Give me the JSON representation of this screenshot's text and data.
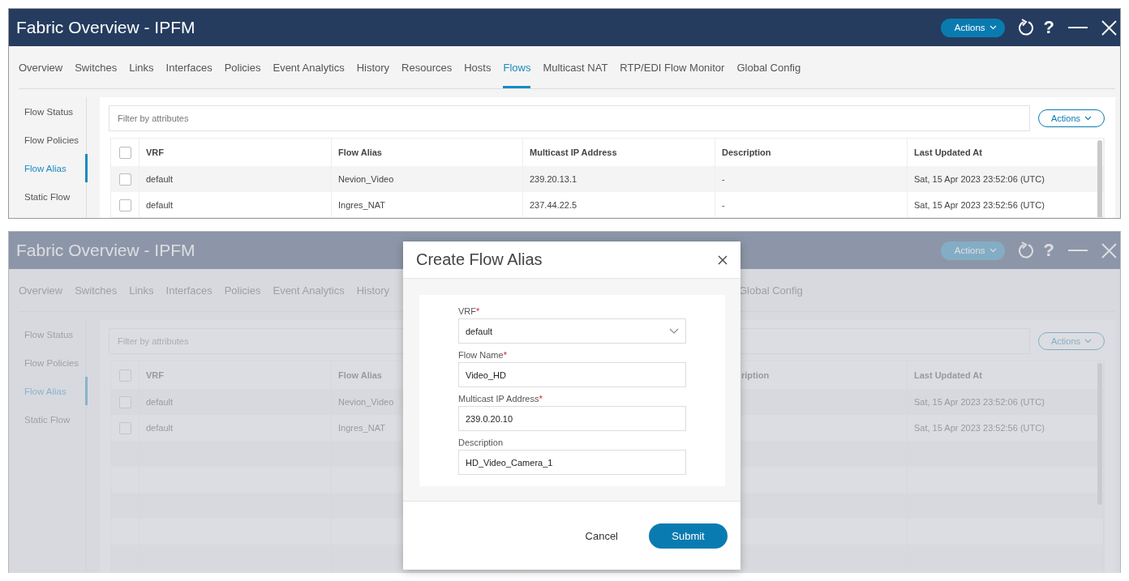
{
  "main_window": {
    "title": "Fabric Overview - IPFM",
    "header_actions_button": "Actions",
    "help_button": "?",
    "tabs": [
      {
        "label": "Overview",
        "selected": false
      },
      {
        "label": "Switches",
        "selected": false
      },
      {
        "label": "Links",
        "selected": false
      },
      {
        "label": "Interfaces",
        "selected": false
      },
      {
        "label": "Policies",
        "selected": false
      },
      {
        "label": "Event Analytics",
        "selected": false
      },
      {
        "label": "History",
        "selected": false
      },
      {
        "label": "Resources",
        "selected": false
      },
      {
        "label": "Hosts",
        "selected": false
      },
      {
        "label": "Flows",
        "selected": true
      },
      {
        "label": "Multicast NAT",
        "selected": false
      },
      {
        "label": "RTP/EDI Flow Monitor",
        "selected": false
      },
      {
        "label": "Global Config",
        "selected": false
      }
    ],
    "side_nav": [
      {
        "label": "Flow Status",
        "selected": false
      },
      {
        "label": "Flow Policies",
        "selected": false
      },
      {
        "label": "Flow Alias",
        "selected": true
      },
      {
        "label": "Static Flow",
        "selected": false
      }
    ],
    "filter": {
      "placeholder": "Filter by attributes"
    },
    "table_actions_button": "Actions",
    "table": {
      "select_all_checked": false,
      "columns": {
        "vrf": "VRF",
        "flow_alias": "Flow Alias",
        "multicast_ip_address": "Multicast IP Address",
        "description": "Description",
        "last_updated_at": "Last Updated At"
      },
      "rows": [
        {
          "checked": false,
          "vrf": "default",
          "flow_alias": "Nevion_Video",
          "multicast_ip_address": "239.20.13.1",
          "description": "-",
          "last_updated_at": "Sat, 15 Apr 2023 23:52:06 (UTC)"
        },
        {
          "checked": false,
          "vrf": "default",
          "flow_alias": "Ingres_NAT",
          "multicast_ip_address": "237.44.22.5",
          "description": "-",
          "last_updated_at": "Sat, 15 Apr 2023 23:52:56 (UTC)"
        }
      ]
    }
  },
  "dimmed_window": {
    "title": "Fabric Overview - IPFM",
    "header_actions_button": "Actions",
    "help_button": "?",
    "tabs": [
      {
        "label": "Overview",
        "selected": false
      },
      {
        "label": "Switches",
        "selected": false
      },
      {
        "label": "Links",
        "selected": false
      },
      {
        "label": "Interfaces",
        "selected": false
      },
      {
        "label": "Policies",
        "selected": false
      },
      {
        "label": "Event Analytics",
        "selected": false
      },
      {
        "label": "History",
        "selected": false
      }
    ],
    "tabs_right": [
      {
        "label": "Global Config",
        "selected": false
      }
    ],
    "side_nav": [
      {
        "label": "Flow Status",
        "selected": false
      },
      {
        "label": "Flow Policies",
        "selected": false
      },
      {
        "label": "Flow Alias",
        "selected": true
      },
      {
        "label": "Static Flow",
        "selected": false
      }
    ],
    "filter": {
      "placeholder": "Filter by attributes"
    },
    "table_actions_button": "Actions",
    "table": {
      "select_all_checked": false,
      "columns": {
        "vrf": "VRF",
        "flow_alias": "Flow Alias",
        "description": "ription",
        "last_updated_at": "Last Updated At"
      },
      "rows": [
        {
          "checked": false,
          "vrf": "default",
          "flow_alias": "Nevion_Video",
          "last_updated_at": "Sat, 15 Apr 2023 23:52:06 (UTC)"
        },
        {
          "checked": false,
          "vrf": "default",
          "flow_alias": "Ingres_NAT",
          "last_updated_at": "Sat, 15 Apr 2023 23:52:56 (UTC)"
        }
      ]
    }
  },
  "modal": {
    "title": "Create Flow Alias",
    "fields": [
      {
        "label": "VRF",
        "required": true,
        "kind": "select",
        "value": "default"
      },
      {
        "label": "Flow Name",
        "required": true,
        "kind": "text",
        "value": "Video_HD"
      },
      {
        "label": "Multicast IP Address",
        "required": true,
        "kind": "text",
        "value": "239.0.20.10"
      },
      {
        "label": "Description",
        "required": false,
        "kind": "text",
        "value": "HD_Video_Camera_1"
      }
    ],
    "required_mark": "*",
    "buttons": [
      {
        "label": "Cancel",
        "kind": "secondary"
      },
      {
        "label": "Submit",
        "kind": "primary"
      }
    ]
  }
}
